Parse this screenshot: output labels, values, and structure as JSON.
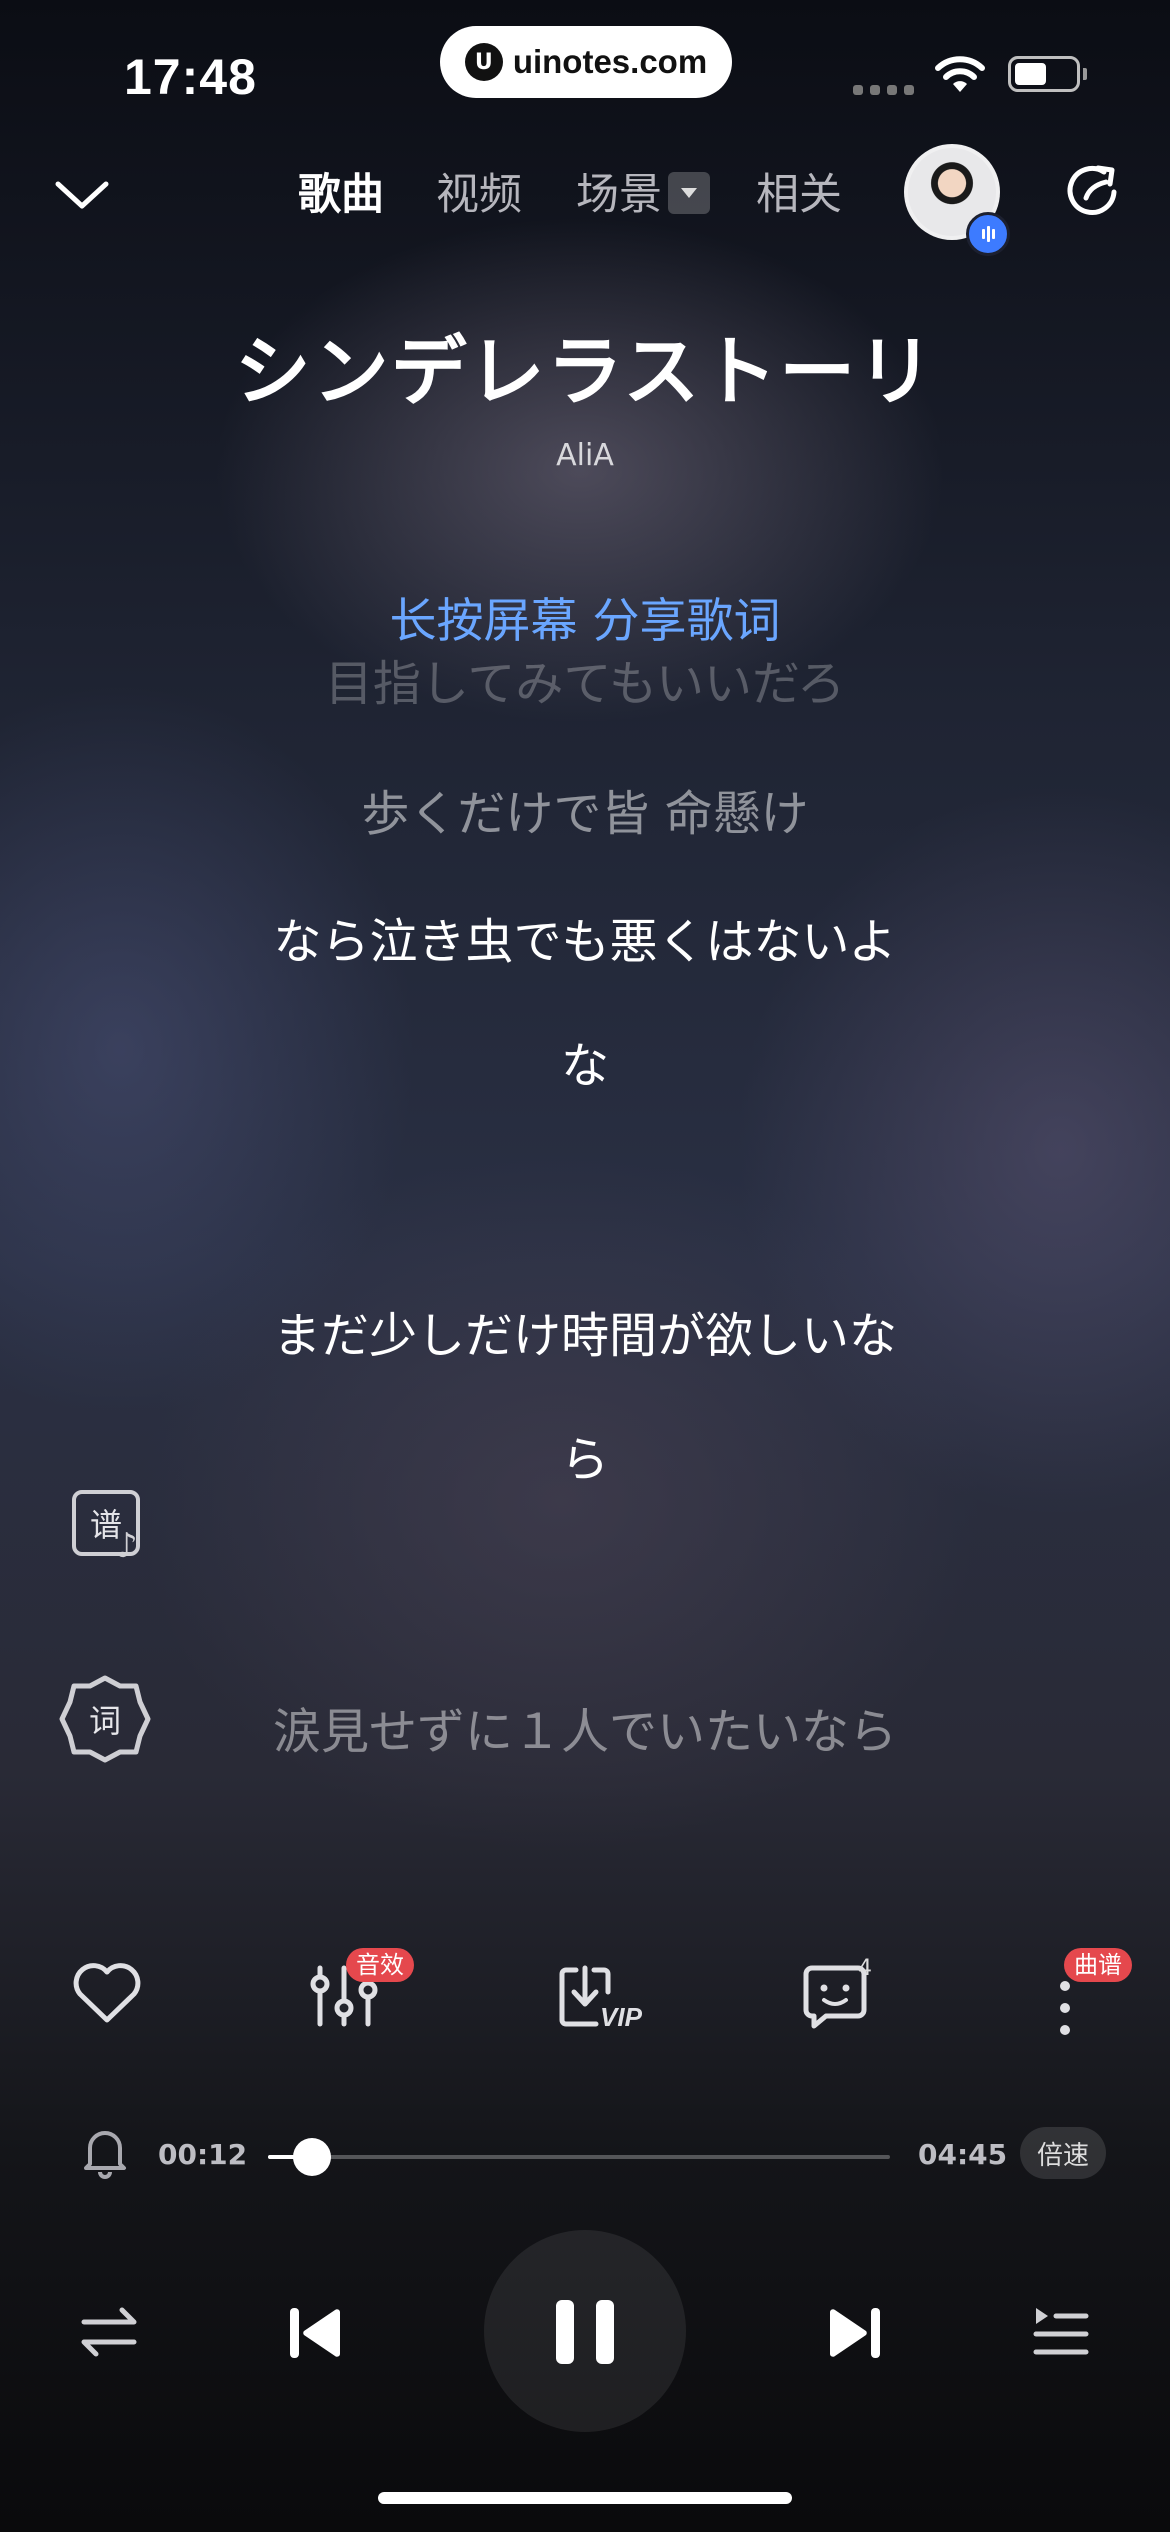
{
  "status_bar": {
    "time": "17:48",
    "url": "uinotes.com",
    "url_logo": "U"
  },
  "nav": {
    "tabs": [
      {
        "label": "歌曲",
        "active": true
      },
      {
        "label": "视频",
        "active": false
      },
      {
        "label": "场景",
        "active": false
      },
      {
        "label": "相关",
        "active": false
      }
    ]
  },
  "song": {
    "title": "シンデレラストーリ",
    "artist": "AliA"
  },
  "lyrics": {
    "hint": "长按屏幕 分享歌词",
    "lines": [
      "目指してみてもいいだろ",
      "歩くだけで皆 命懸け",
      "なら泣き虫でも悪くはないよ",
      "な",
      "まだ少しだけ時間が欲しいな",
      "ら",
      "涙見せずに１人でいたいなら"
    ]
  },
  "side_buttons": {
    "score_label": "谱",
    "lyric_label": "词"
  },
  "actions": {
    "effect_badge": "音效",
    "download_tag": "VIP",
    "comment_count": "4",
    "more_badge": "曲谱"
  },
  "progress": {
    "current": "00:12",
    "total": "04:45",
    "fraction": 0.07,
    "speed_label": "倍速"
  },
  "icons": {
    "collapse": "chevron-down-icon",
    "share": "share-icon",
    "like": "heart-icon",
    "equalizer": "equalizer-icon",
    "download": "download-icon",
    "comment": "comment-icon",
    "more": "more-icon",
    "alarm": "bell-icon",
    "mode": "repeat-icon",
    "previous": "previous-icon",
    "pause": "pause-icon",
    "next": "next-icon",
    "playlist": "playlist-icon"
  },
  "colors": {
    "accent": "#6aa6ff",
    "badge": "#e5484d",
    "avatar_badge": "#3d7bff"
  }
}
